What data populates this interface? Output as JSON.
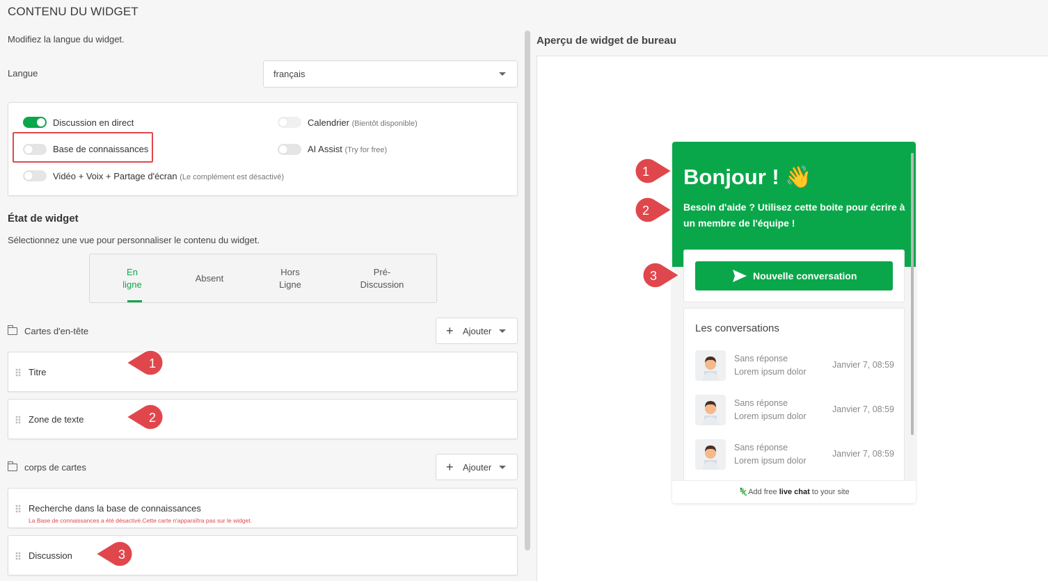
{
  "page": {
    "title": "CONTENU DU WIDGET"
  },
  "language": {
    "description": "Modifiez la langue du widget.",
    "label": "Langue",
    "selected": "français"
  },
  "features": [
    {
      "label": "Discussion en direct",
      "note": "",
      "enabled": true
    },
    {
      "label": "Calendrier",
      "note": "(Bientôt disponible)",
      "enabled": false
    },
    {
      "label": "Base de connaissances",
      "note": "",
      "enabled": false
    },
    {
      "label": "AI Assist",
      "note": "(Try for free)",
      "enabled": false
    },
    {
      "label": "Vidéo + Voix + Partage d'écran",
      "note": "(Le complément est désactivé)",
      "enabled": false
    }
  ],
  "widget_state": {
    "heading": "État de widget",
    "description": "Sélectionnez une vue pour personnaliser le contenu du widget.",
    "tabs": [
      {
        "line1": "En",
        "line2": "ligne",
        "active": true
      },
      {
        "line1": "Absent",
        "line2": "",
        "active": false
      },
      {
        "line1": "Hors",
        "line2": "Ligne",
        "active": false
      },
      {
        "line1": "Pré-",
        "line2": "Discussion",
        "active": false
      }
    ]
  },
  "header_cards": {
    "label": "Cartes d'en-tête",
    "add_label": "Ajouter",
    "items": [
      "Titre",
      "Zone de texte"
    ]
  },
  "body_cards": {
    "label": "corps de cartes",
    "add_label": "Ajouter",
    "items": [
      {
        "label": "Recherche dans la base de connaissances",
        "warning": "La Base de connaissances a été désactivé.Cette carte n'apparaîtra pas sur le widget."
      },
      {
        "label": "Discussion",
        "warning": ""
      }
    ]
  },
  "markers": [
    "1",
    "2",
    "3",
    "1",
    "2",
    "3"
  ],
  "preview": {
    "title": "Aperçu de widget de bureau",
    "greeting": "Bonjour ! 👋",
    "subtitle": "Besoin d'aide ? Utilisez cette boite pour écrire à un membre de l'équipe !",
    "new_conversation": "Nouvelle conversation",
    "conversations_title": "Les conversations",
    "conversations": [
      {
        "status": "Sans réponse",
        "message": "Lorem ipsum dolor",
        "time": "Janvier 7, 08:59"
      },
      {
        "status": "Sans réponse",
        "message": "Lorem ipsum dolor",
        "time": "Janvier 7, 08:59"
      },
      {
        "status": "Sans réponse",
        "message": "Lorem ipsum dolor",
        "time": "Janvier 7, 08:59"
      }
    ],
    "footer_prefix": "Add free ",
    "footer_bold": "live chat",
    "footer_suffix": " to your site"
  },
  "colors": {
    "accent": "#0aa74a",
    "marker": "#e0474c"
  }
}
